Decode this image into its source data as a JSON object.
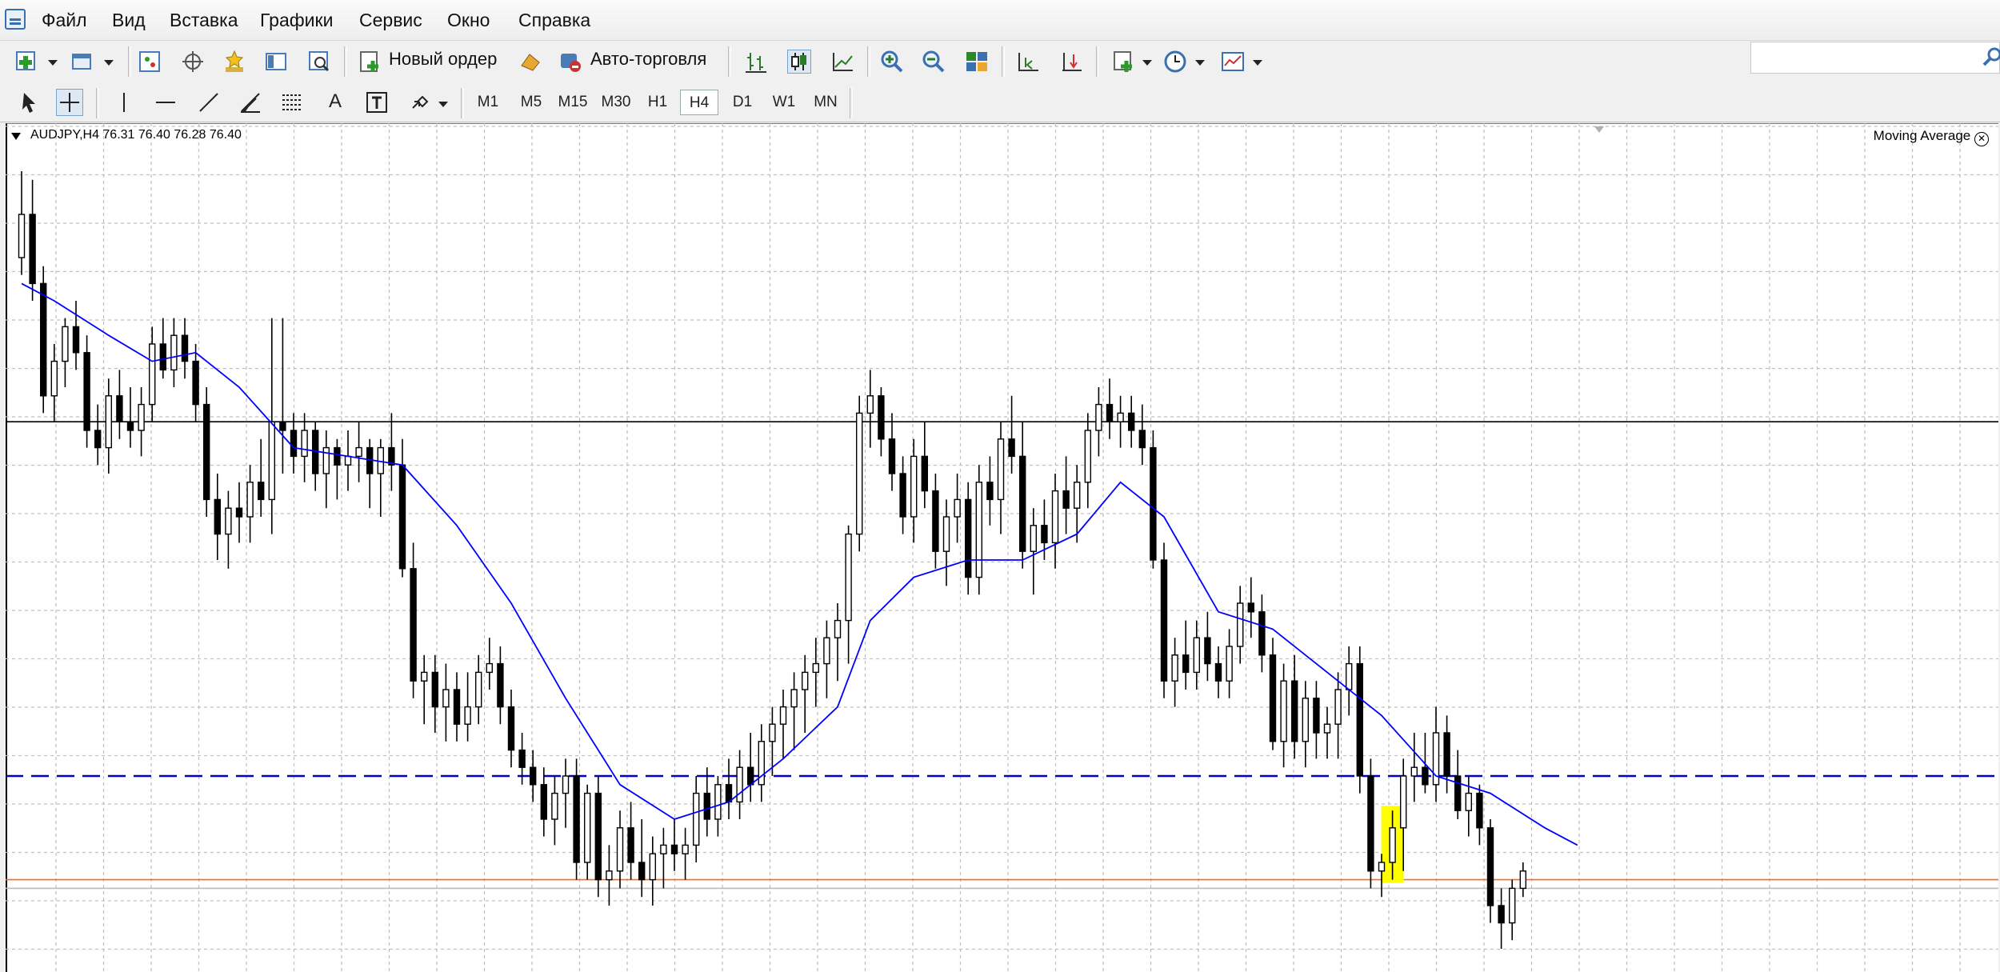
{
  "menu": [
    "Файл",
    "Вид",
    "Вставка",
    "Графики",
    "Сервис",
    "Окно",
    "Справка"
  ],
  "toolbar": {
    "new_order": "Новый ордер",
    "auto_trading": "Авто-торговля",
    "icons": [
      "new-chart-icon",
      "profiles-icon",
      "market-watch-icon",
      "navigator-icon",
      "favorites-icon",
      "data-window-icon",
      "strategy-tester-icon",
      "new-order-icon",
      "auto-trading-icon",
      "bar-chart-icon",
      "candlestick-icon",
      "line-chart-icon",
      "zoom-in-icon",
      "zoom-out-icon",
      "tile-windows-icon",
      "chart-shift-icon",
      "autoscroll-icon",
      "indicators-icon",
      "periods-icon",
      "templates-icon"
    ]
  },
  "timeframes": [
    "M1",
    "M5",
    "M15",
    "M30",
    "H1",
    "H4",
    "D1",
    "W1",
    "MN"
  ],
  "active_timeframe": "H4",
  "drawing_tools": [
    "cursor-icon",
    "crosshair-icon",
    "vertical-line-icon",
    "horizontal-line-icon",
    "trendline-icon",
    "fibonacci-fan-icon",
    "fibonacci-icon",
    "text-icon",
    "text-label-icon",
    "arrows-icon"
  ],
  "chart": {
    "symbol_line": "AUDJPY,H4  76.31 76.40 76.28 76.40",
    "indicator": "Moving Average",
    "colors": {
      "ma": "#0000ff",
      "level_blue": "#0000cc",
      "level_orange": "#ff6a1a",
      "highlight": "#ffff00",
      "candle": "#000000"
    }
  },
  "chart_data": {
    "type": "candlestick",
    "symbol": "AUDJPY",
    "timeframe": "H4",
    "ohlc_last": {
      "open": 76.31,
      "high": 76.4,
      "low": 76.28,
      "close": 76.4
    },
    "indicators": [
      "Moving Average"
    ],
    "grid": true,
    "candles": [
      [
        0.77,
        0.87,
        0.75,
        0.82
      ],
      [
        0.82,
        0.86,
        0.72,
        0.74
      ],
      [
        0.74,
        0.76,
        0.59,
        0.61
      ],
      [
        0.61,
        0.67,
        0.58,
        0.65
      ],
      [
        0.65,
        0.7,
        0.62,
        0.69
      ],
      [
        0.69,
        0.72,
        0.64,
        0.66
      ],
      [
        0.66,
        0.68,
        0.55,
        0.57
      ],
      [
        0.57,
        0.6,
        0.53,
        0.55
      ],
      [
        0.55,
        0.63,
        0.52,
        0.61
      ],
      [
        0.61,
        0.64,
        0.56,
        0.58
      ],
      [
        0.58,
        0.62,
        0.55,
        0.57
      ],
      [
        0.57,
        0.62,
        0.54,
        0.6
      ],
      [
        0.6,
        0.69,
        0.58,
        0.67
      ],
      [
        0.67,
        0.7,
        0.63,
        0.64
      ],
      [
        0.64,
        0.7,
        0.62,
        0.68
      ],
      [
        0.68,
        0.7,
        0.63,
        0.65
      ],
      [
        0.65,
        0.67,
        0.58,
        0.6
      ],
      [
        0.6,
        0.62,
        0.47,
        0.49
      ],
      [
        0.49,
        0.52,
        0.42,
        0.45
      ],
      [
        0.45,
        0.5,
        0.41,
        0.48
      ],
      [
        0.48,
        0.51,
        0.44,
        0.47
      ],
      [
        0.47,
        0.53,
        0.44,
        0.51
      ],
      [
        0.51,
        0.56,
        0.47,
        0.49
      ],
      [
        0.49,
        0.7,
        0.45,
        0.58
      ],
      [
        0.58,
        0.7,
        0.52,
        0.57
      ],
      [
        0.57,
        0.59,
        0.52,
        0.54
      ],
      [
        0.54,
        0.59,
        0.51,
        0.57
      ],
      [
        0.57,
        0.58,
        0.5,
        0.52
      ],
      [
        0.52,
        0.57,
        0.48,
        0.55
      ],
      [
        0.55,
        0.56,
        0.49,
        0.53
      ],
      [
        0.53,
        0.57,
        0.5,
        0.54
      ],
      [
        0.54,
        0.58,
        0.51,
        0.55
      ],
      [
        0.55,
        0.56,
        0.48,
        0.52
      ],
      [
        0.52,
        0.56,
        0.47,
        0.55
      ],
      [
        0.55,
        0.59,
        0.5,
        0.53
      ],
      [
        0.53,
        0.56,
        0.4,
        0.41
      ],
      [
        0.41,
        0.44,
        0.26,
        0.28
      ],
      [
        0.28,
        0.31,
        0.23,
        0.29
      ],
      [
        0.29,
        0.31,
        0.22,
        0.25
      ],
      [
        0.25,
        0.3,
        0.21,
        0.27
      ],
      [
        0.27,
        0.29,
        0.21,
        0.23
      ],
      [
        0.23,
        0.29,
        0.21,
        0.25
      ],
      [
        0.25,
        0.31,
        0.23,
        0.29
      ],
      [
        0.29,
        0.33,
        0.27,
        0.3
      ],
      [
        0.3,
        0.32,
        0.23,
        0.25
      ],
      [
        0.25,
        0.27,
        0.18,
        0.2
      ],
      [
        0.2,
        0.22,
        0.16,
        0.18
      ],
      [
        0.18,
        0.2,
        0.14,
        0.16
      ],
      [
        0.16,
        0.18,
        0.1,
        0.12
      ],
      [
        0.12,
        0.17,
        0.09,
        0.15
      ],
      [
        0.15,
        0.19,
        0.11,
        0.17
      ],
      [
        0.17,
        0.19,
        0.05,
        0.07
      ],
      [
        0.07,
        0.16,
        0.05,
        0.15
      ],
      [
        0.15,
        0.17,
        0.03,
        0.05
      ],
      [
        0.05,
        0.09,
        0.02,
        0.06
      ],
      [
        0.06,
        0.13,
        0.04,
        0.11
      ],
      [
        0.11,
        0.14,
        0.05,
        0.07
      ],
      [
        0.07,
        0.12,
        0.03,
        0.05
      ],
      [
        0.05,
        0.1,
        0.02,
        0.08
      ],
      [
        0.08,
        0.11,
        0.04,
        0.09
      ],
      [
        0.09,
        0.12,
        0.06,
        0.08
      ],
      [
        0.08,
        0.11,
        0.05,
        0.09
      ],
      [
        0.09,
        0.17,
        0.07,
        0.15
      ],
      [
        0.15,
        0.18,
        0.1,
        0.12
      ],
      [
        0.12,
        0.17,
        0.1,
        0.16
      ],
      [
        0.16,
        0.19,
        0.12,
        0.14
      ],
      [
        0.14,
        0.2,
        0.12,
        0.18
      ],
      [
        0.18,
        0.22,
        0.14,
        0.16
      ],
      [
        0.16,
        0.23,
        0.14,
        0.21
      ],
      [
        0.21,
        0.25,
        0.17,
        0.23
      ],
      [
        0.23,
        0.27,
        0.19,
        0.25
      ],
      [
        0.25,
        0.29,
        0.2,
        0.27
      ],
      [
        0.27,
        0.31,
        0.22,
        0.29
      ],
      [
        0.29,
        0.33,
        0.25,
        0.3
      ],
      [
        0.3,
        0.35,
        0.26,
        0.33
      ],
      [
        0.33,
        0.37,
        0.28,
        0.35
      ],
      [
        0.35,
        0.46,
        0.3,
        0.45
      ],
      [
        0.45,
        0.61,
        0.43,
        0.59
      ],
      [
        0.59,
        0.64,
        0.55,
        0.61
      ],
      [
        0.61,
        0.62,
        0.54,
        0.56
      ],
      [
        0.56,
        0.59,
        0.5,
        0.52
      ],
      [
        0.52,
        0.54,
        0.45,
        0.47
      ],
      [
        0.47,
        0.56,
        0.44,
        0.54
      ],
      [
        0.54,
        0.58,
        0.48,
        0.5
      ],
      [
        0.5,
        0.52,
        0.41,
        0.43
      ],
      [
        0.43,
        0.49,
        0.39,
        0.47
      ],
      [
        0.47,
        0.52,
        0.44,
        0.49
      ],
      [
        0.49,
        0.51,
        0.38,
        0.4
      ],
      [
        0.4,
        0.53,
        0.38,
        0.51
      ],
      [
        0.51,
        0.54,
        0.46,
        0.49
      ],
      [
        0.49,
        0.58,
        0.45,
        0.56
      ],
      [
        0.56,
        0.61,
        0.52,
        0.54
      ],
      [
        0.54,
        0.58,
        0.41,
        0.43
      ],
      [
        0.43,
        0.48,
        0.38,
        0.46
      ],
      [
        0.46,
        0.49,
        0.42,
        0.44
      ],
      [
        0.44,
        0.52,
        0.41,
        0.5
      ],
      [
        0.5,
        0.54,
        0.45,
        0.48
      ],
      [
        0.48,
        0.53,
        0.44,
        0.51
      ],
      [
        0.51,
        0.59,
        0.48,
        0.57
      ],
      [
        0.57,
        0.62,
        0.54,
        0.6
      ],
      [
        0.6,
        0.63,
        0.56,
        0.58
      ],
      [
        0.58,
        0.61,
        0.55,
        0.59
      ],
      [
        0.59,
        0.61,
        0.55,
        0.57
      ],
      [
        0.57,
        0.6,
        0.53,
        0.55
      ],
      [
        0.55,
        0.57,
        0.41,
        0.42
      ],
      [
        0.42,
        0.44,
        0.26,
        0.28
      ],
      [
        0.28,
        0.33,
        0.25,
        0.31
      ],
      [
        0.31,
        0.35,
        0.27,
        0.29
      ],
      [
        0.29,
        0.35,
        0.27,
        0.33
      ],
      [
        0.33,
        0.36,
        0.28,
        0.3
      ],
      [
        0.3,
        0.32,
        0.26,
        0.28
      ],
      [
        0.28,
        0.34,
        0.26,
        0.32
      ],
      [
        0.32,
        0.39,
        0.3,
        0.37
      ],
      [
        0.37,
        0.4,
        0.33,
        0.36
      ],
      [
        0.36,
        0.38,
        0.29,
        0.31
      ],
      [
        0.31,
        0.33,
        0.2,
        0.21
      ],
      [
        0.21,
        0.3,
        0.18,
        0.28
      ],
      [
        0.28,
        0.31,
        0.19,
        0.21
      ],
      [
        0.21,
        0.28,
        0.18,
        0.26
      ],
      [
        0.26,
        0.28,
        0.19,
        0.22
      ],
      [
        0.22,
        0.25,
        0.19,
        0.23
      ],
      [
        0.23,
        0.29,
        0.19,
        0.27
      ],
      [
        0.27,
        0.32,
        0.24,
        0.3
      ],
      [
        0.3,
        0.32,
        0.15,
        0.17
      ],
      [
        0.17,
        0.19,
        0.04,
        0.06
      ],
      [
        0.06,
        0.08,
        0.03,
        0.07
      ],
      [
        0.07,
        0.13,
        0.05,
        0.11
      ],
      [
        0.11,
        0.19,
        0.06,
        0.17
      ],
      [
        0.17,
        0.22,
        0.14,
        0.18
      ],
      [
        0.18,
        0.22,
        0.15,
        0.16
      ],
      [
        0.16,
        0.25,
        0.14,
        0.22
      ],
      [
        0.22,
        0.24,
        0.15,
        0.17
      ],
      [
        0.17,
        0.2,
        0.12,
        0.13
      ],
      [
        0.13,
        0.17,
        0.1,
        0.15
      ],
      [
        0.15,
        0.16,
        0.09,
        0.11
      ],
      [
        0.11,
        0.12,
        0.0,
        0.02
      ],
      [
        0.02,
        0.04,
        -0.03,
        0.0
      ],
      [
        0.0,
        0.05,
        -0.02,
        0.04
      ],
      [
        0.04,
        0.07,
        0.03,
        0.06
      ]
    ],
    "moving_average": [
      [
        0,
        0.74
      ],
      [
        3,
        0.72
      ],
      [
        8,
        0.68
      ],
      [
        12,
        0.65
      ],
      [
        16,
        0.66
      ],
      [
        20,
        0.62
      ],
      [
        25,
        0.55
      ],
      [
        30,
        0.54
      ],
      [
        35,
        0.53
      ],
      [
        40,
        0.46
      ],
      [
        45,
        0.37
      ],
      [
        50,
        0.26
      ],
      [
        55,
        0.16
      ],
      [
        60,
        0.12
      ],
      [
        65,
        0.14
      ],
      [
        70,
        0.19
      ],
      [
        75,
        0.25
      ],
      [
        78,
        0.35
      ],
      [
        82,
        0.4
      ],
      [
        87,
        0.42
      ],
      [
        92,
        0.42
      ],
      [
        97,
        0.45
      ],
      [
        101,
        0.51
      ],
      [
        105,
        0.47
      ],
      [
        110,
        0.36
      ],
      [
        115,
        0.34
      ],
      [
        120,
        0.29
      ],
      [
        125,
        0.24
      ],
      [
        130,
        0.17
      ],
      [
        135,
        0.15
      ],
      [
        140,
        0.11
      ],
      [
        143,
        0.09
      ]
    ],
    "horizontal_levels": [
      {
        "value": 0.17,
        "style": "dashed",
        "color": "#0000cc"
      },
      {
        "value": 0.05,
        "style": "solid",
        "color": "#ff6a1a"
      },
      {
        "value": 0.04,
        "style": "solid",
        "color": "#bbbbbb"
      },
      {
        "value": 0.58,
        "style": "solid",
        "color": "#000000"
      }
    ],
    "highlight_candle_index": 126
  }
}
